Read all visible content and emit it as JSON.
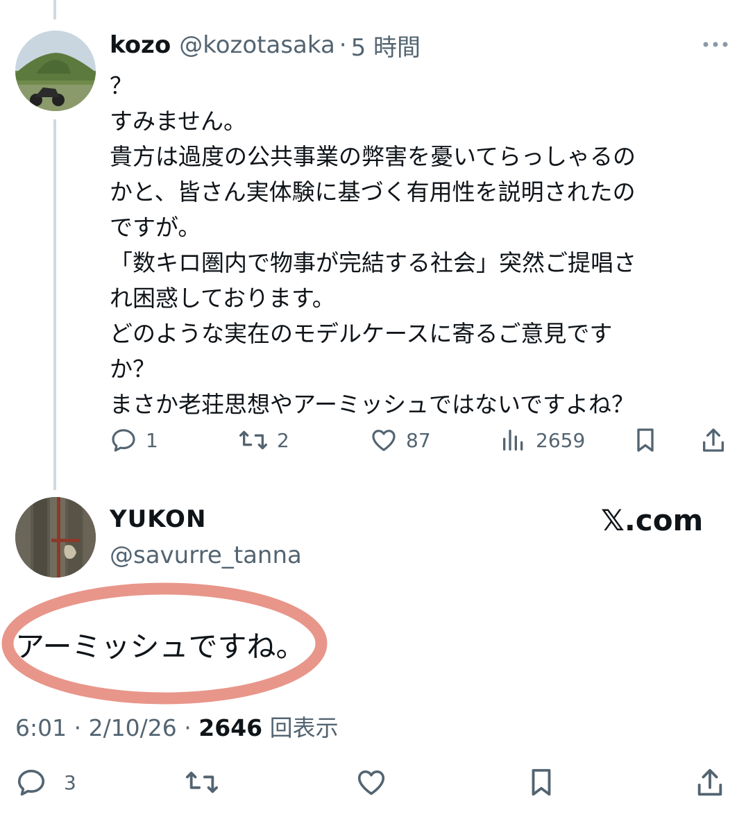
{
  "reply": {
    "name": "kozo",
    "handle": "@kozotasaka",
    "separator": "·",
    "time": "5 時間",
    "lines": [
      "？",
      "すみません。",
      "貴方は過度の公共事業の弊害を憂いてらっしゃるの",
      "かと、皆さん実体験に基づく有用性を説明されたの",
      "ですが。",
      "「数キロ圏内で物事が完結する社会」突然ご提唱さ",
      "れ困惑しております。",
      "どのような実在のモデルケースに寄るご意見です",
      "か？",
      "まさか老荘思想やアーミッシュではないですよね？"
    ],
    "stats": {
      "replies": "1",
      "reposts": "2",
      "likes": "87",
      "views": "2659"
    }
  },
  "main": {
    "name": "YUKON",
    "handle": "@savurre_tanna",
    "text": "アーミッシュですね。",
    "time": "6:01 · 2/10/26 ·",
    "views_count": "2646",
    "views_label": "回表示",
    "stats": {
      "replies": "3"
    }
  },
  "watermark": "𝕏.com",
  "icons": {
    "reply": "reply-icon",
    "repost": "repost-icon",
    "like": "heart-icon",
    "views": "views-icon",
    "bookmark": "bookmark-icon",
    "share": "share-icon",
    "more": "more-icon"
  },
  "colors": {
    "text": "#0f1419",
    "secondary": "#536471",
    "thread_line": "#cfd9de",
    "highlight_circle": "#e8968a"
  }
}
